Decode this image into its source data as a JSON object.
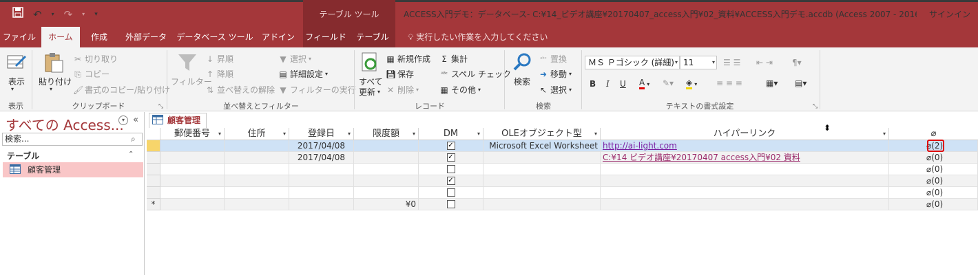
{
  "app": {
    "doc_title": "ACCESS入門デモ：データベース- C:¥14_ビデオ講座¥20170407_access入門¥02_資料¥ACCESS入門デモ.accdb (Access 2007 - 2016 ファイ…",
    "signin": "サインイン",
    "tool_tab_label": "テーブル ツール",
    "tell_me": "実行したい作業を入力してください"
  },
  "tabs": [
    {
      "label": "ファイル"
    },
    {
      "label": "ホーム"
    },
    {
      "label": "作成"
    },
    {
      "label": "外部データ"
    },
    {
      "label": "データベース ツール"
    },
    {
      "label": "アドイン"
    },
    {
      "label": "フィールド"
    },
    {
      "label": "テーブル"
    }
  ],
  "ribbon": {
    "view": {
      "label": "表示",
      "group": "表示"
    },
    "clipboard": {
      "paste": "貼り付け",
      "cut": "切り取り",
      "copy": "コピー",
      "format_painter": "書式のコピー/貼り付け",
      "group": "クリップボード"
    },
    "sort": {
      "filter": "フィルター",
      "asc": "昇順",
      "desc": "降順",
      "clear": "並べ替えの解除",
      "select": "選択",
      "advanced": "詳細設定",
      "toggle": "フィルターの実行",
      "group": "並べ替えとフィルター"
    },
    "records": {
      "refresh_line1": "すべて",
      "refresh_line2": "更新",
      "new": "新規作成",
      "save": "保存",
      "delete": "削除",
      "totals": "集計",
      "spelling": "スペル チェック",
      "more": "その他",
      "group": "レコード"
    },
    "find": {
      "find": "検索",
      "replace": "置換",
      "goto": "移動",
      "select": "選択",
      "group": "検索"
    },
    "text": {
      "font": "ＭＳ Ｐゴシック (詳細)",
      "size": "11",
      "bold": "B",
      "italic": "I",
      "underline": "U",
      "group": "テキストの書式設定"
    }
  },
  "nav": {
    "title": "すべての Access...",
    "search_placeholder": "検索...",
    "group": "テーブル",
    "item": "顧客管理"
  },
  "doc_tab": "顧客管理",
  "table": {
    "columns": [
      "郵便番号",
      "住所",
      "登録日",
      "限度額",
      "DM",
      "OLEオブジェクト型",
      "ハイパーリンク",
      "⌀"
    ],
    "rows": [
      {
        "date": "2017/04/08",
        "limit": "",
        "dm": true,
        "ole": "Microsoft Excel Worksheet",
        "link": "http://ai-light.com",
        "attach": "(2)"
      },
      {
        "date": "2017/04/08",
        "limit": "",
        "dm": true,
        "ole": "",
        "link": "C:¥14 ビデオ講座¥20170407 access入門¥02 資料",
        "attach": "(0)"
      },
      {
        "date": "",
        "limit": "",
        "dm": false,
        "ole": "",
        "link": "",
        "attach": "(0)"
      },
      {
        "date": "",
        "limit": "",
        "dm": true,
        "ole": "",
        "link": "",
        "attach": "(0)"
      },
      {
        "date": "",
        "limit": "",
        "dm": false,
        "ole": "",
        "link": "",
        "attach": "(0)"
      },
      {
        "date": "",
        "limit": "¥0",
        "dm": false,
        "ole": "",
        "link": "",
        "attach": "(0)"
      }
    ],
    "new_row_marker": "*",
    "colors": {
      "accent": "#a4373a",
      "selected_row": "#cfe2f6",
      "nav_selected": "#f9c6c7",
      "highlight_box": "#e00000"
    }
  }
}
